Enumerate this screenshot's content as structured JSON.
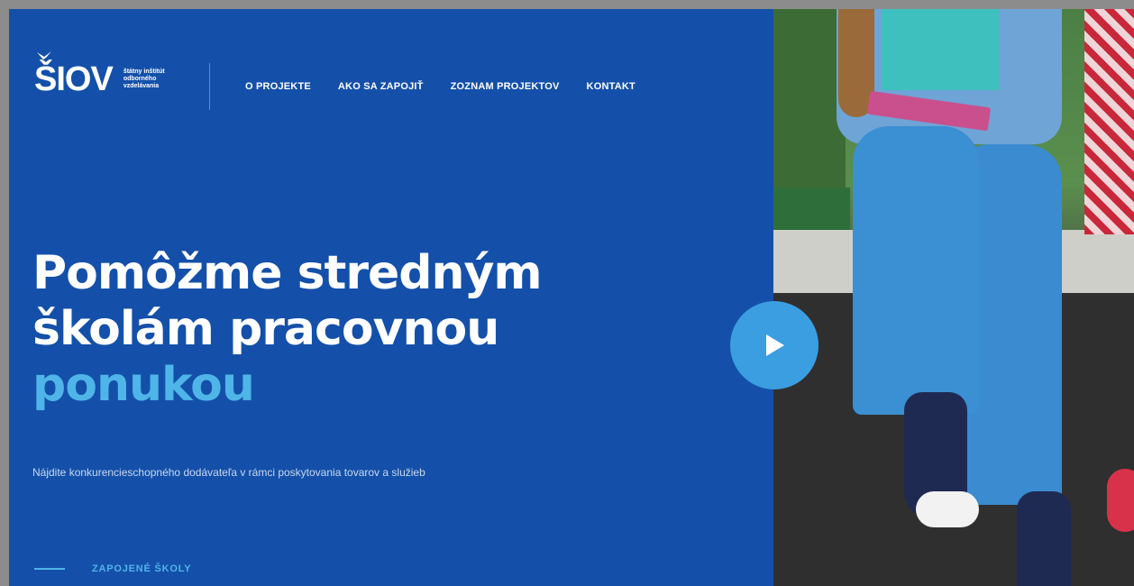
{
  "brand": {
    "logo_text": "ŠIOV",
    "logo_subtitle": "štátny inštitút odborného vzdelávania"
  },
  "nav": {
    "items": [
      {
        "label": "O PROJEKTE"
      },
      {
        "label": "AKO SA ZAPOJIŤ"
      },
      {
        "label": "ZOZNAM PROJEKTOV"
      },
      {
        "label": "KONTAKT"
      }
    ]
  },
  "hero": {
    "title_line1": "Pomôžme stredným",
    "title_line2": "školám pracovnou",
    "title_accent": "ponukou",
    "subtitle": "Nájdite konkurencieschopného dodávateľa v rámci poskytovania tovarov a služieb",
    "scroll_link": "ZAPOJENÉ ŠKOLY"
  },
  "colors": {
    "panel_bg": "#1450a9",
    "accent": "#4fb5e8",
    "play_button": "#3a9ee0"
  },
  "icons": {
    "play": "play-icon",
    "logo_bird": "bird-icon"
  }
}
